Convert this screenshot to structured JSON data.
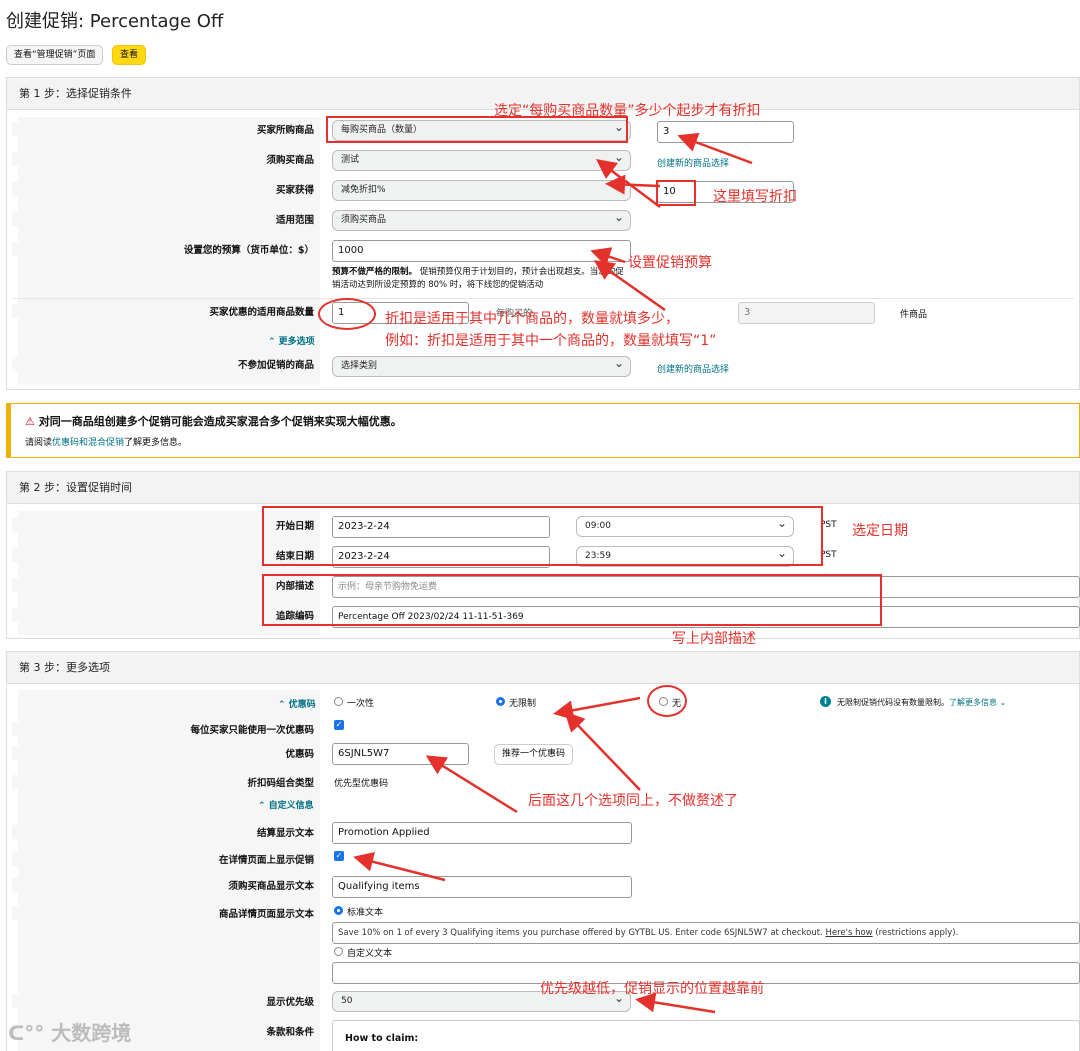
{
  "page_title": "创建促销: Percentage Off",
  "top_buttons": {
    "view_manage": "查看“管理促销”页面",
    "view": "查看"
  },
  "step1": {
    "title": "第 1 步：选择促销条件",
    "buyer_purchases_label": "买家所购商品",
    "buyer_purchases_value": "每购买商品（数量）",
    "buyer_purchases_qty": "3",
    "purchased_items_label": "须购买商品",
    "purchased_items_value": "测试",
    "create_selection_link": "创建新的商品选择",
    "buyer_gets_label": "买家获得",
    "buyer_gets_value": "减免折扣%",
    "discount_value": "10",
    "applies_to_label": "适用范围",
    "applies_to_value": "须购买商品",
    "budget_label": "设置您的预算（货币单位：$）",
    "budget_value": "1000",
    "budget_note_bold": "预算不做严格的限制。",
    "budget_note": "促销预算仅用于计划目的，预计会出现超支。当您的促销活动达到所设定预算的 80% 时，将下线您的促销活动",
    "qty_label": "买家优惠的适用商品数量",
    "qty_value": "1",
    "qty_mid": "每购买的",
    "qty_right_value": "3",
    "qty_unit": "件商品",
    "more_options": "⌃ 更多选项",
    "excluded_label": "不参加促销的商品",
    "excluded_value": "选择类别",
    "excluded_link": "创建新的商品选择"
  },
  "warning": {
    "title": "对同一商品组创建多个促销可能会造成买家混合多个促销来实现大幅优惠。",
    "body_prefix": "请阅读",
    "body_link": "优惠码和混合促销",
    "body_suffix": "了解更多信息。"
  },
  "step2": {
    "title": "第 2 步：设置促销时间",
    "start_label": "开始日期",
    "start_date": "2023-2-24",
    "start_time": "09:00",
    "tz1": "PST",
    "end_label": "结束日期",
    "end_date": "2023-2-24",
    "end_time": "23:59",
    "tz2": "PST",
    "desc_label": "内部描述",
    "desc_placeholder": "示例：母亲节购物免运费",
    "tracking_label": "追踪编码",
    "tracking_value": "Percentage Off 2023/02/24 11-11-51-369"
  },
  "step3": {
    "title": "第 3 步：更多选项",
    "coupon_label": "⌃ 优惠码",
    "opt_once": "一次性",
    "opt_unlimited": "无限制",
    "opt_none": "无",
    "info_text": "无限制促销代码没有数量限制。",
    "info_link": "了解更多信息 ⌄",
    "once_per_buyer_label": "每位买家只能使用一次优惠码",
    "code_label": "优惠码",
    "code_value": "6SJNL5W7",
    "suggest_button": "推荐一个优惠码",
    "combo_label": "折扣码组合类型",
    "combo_value": "优先型优惠码",
    "custom_info": "⌃ 自定义信息",
    "checkout_label": "结算显示文本",
    "checkout_value": "Promotion Applied",
    "show_detail_label": "在详情页面上显示促销",
    "purchased_display_label": "须购买商品显示文本",
    "purchased_display_value": "Qualifying items",
    "detail_text_label": "商品详情页面显示文本",
    "standard_text": "标准文本",
    "standard_value_main": "Save 10% on 1 of every 3 Qualifying items you purchase offered by GYTBL US. Enter code 6SJNL5W7 at checkout.",
    "standard_value_link": "Here's how",
    "standard_value_tail": "(restrictions apply).",
    "custom_text": "自定义文本",
    "priority_label": "显示优先级",
    "priority_value": "50",
    "terms_label": "条款和条件",
    "terms_heading": "How to claim:"
  },
  "annotations": {
    "a1": "选定“每购买商品数量”多少个起步才有折扣",
    "a2": "这里填写折扣",
    "a3": "设置促销预算",
    "a4": "折扣是适用于其中几个商品的，数量就填多少，",
    "a5": "例如：折扣是适用于其中一个商品的，数量就填写“1”",
    "a6": "选定日期",
    "a7": "写上内部描述",
    "a8": "后面这几个选项同上，不做赘述了",
    "a9": "优先级越低，促销显示的位置越靠前"
  },
  "watermark": "大数跨境",
  "colors": {
    "annotation": "#e4312b",
    "link": "#007185",
    "accent": "#ffd814",
    "checkbox": "#1a73e8"
  }
}
